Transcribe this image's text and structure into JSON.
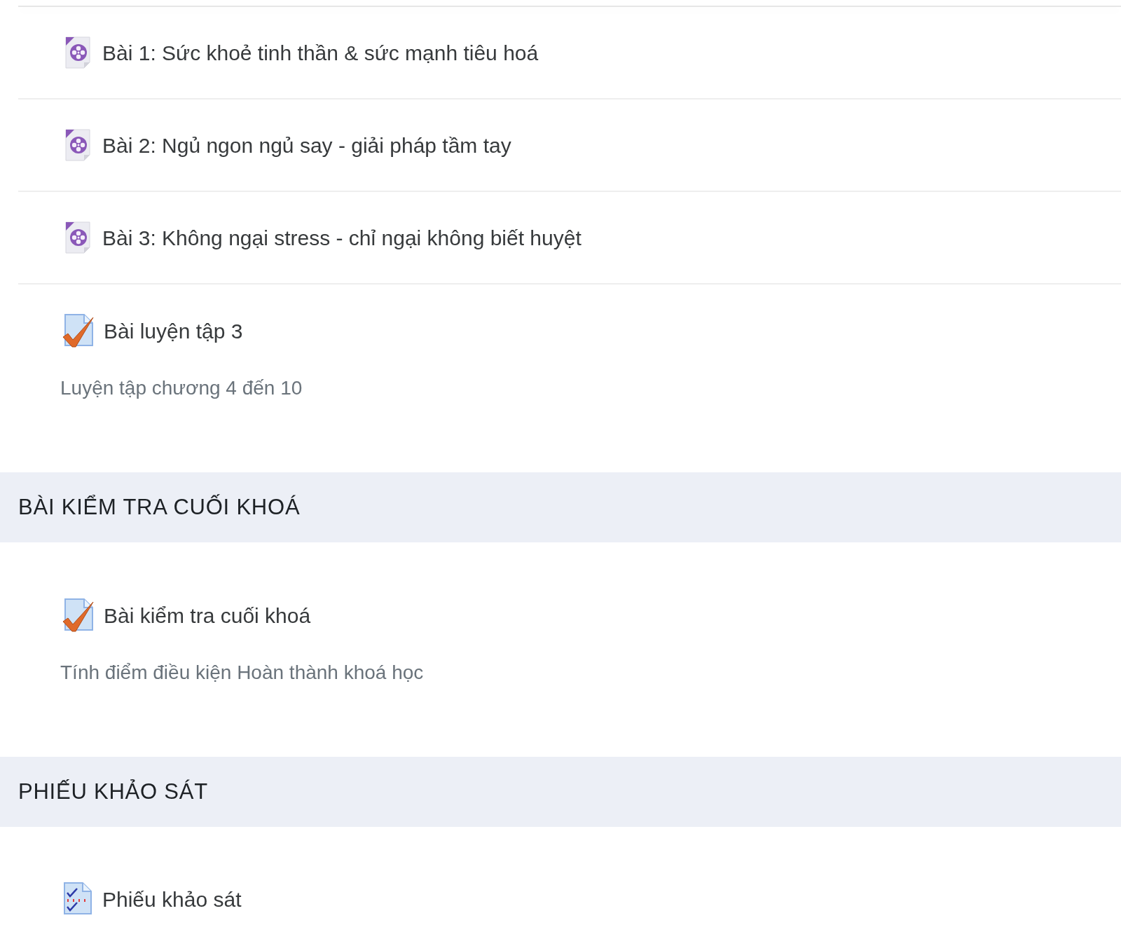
{
  "sections": [
    {
      "activities": [
        {
          "kind": "video",
          "name": "Bài 1: Sức khoẻ tinh thần & sức mạnh tiêu hoá"
        },
        {
          "kind": "video",
          "name": "Bài 2: Ngủ ngon ngủ say - giải pháp tầm tay"
        },
        {
          "kind": "video",
          "name": "Bài 3: Không ngại stress - chỉ ngại không biết huyệt"
        },
        {
          "kind": "quiz",
          "name": "Bài luyện tập 3",
          "description": "Luyện tập chương 4 đến 10"
        }
      ]
    },
    {
      "title": "BÀI KIỂM TRA CUỐI KHOÁ",
      "activities": [
        {
          "kind": "quiz",
          "name": "Bài kiểm tra cuối khoá",
          "description": "Tính điểm điều kiện Hoàn thành khoá học"
        }
      ]
    },
    {
      "title": "PHIẾU KHẢO SÁT",
      "activities": [
        {
          "kind": "survey",
          "name": "Phiếu khảo sát"
        }
      ]
    }
  ]
}
